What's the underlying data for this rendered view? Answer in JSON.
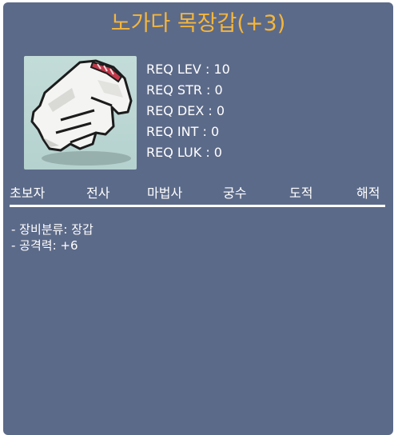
{
  "item": {
    "name": "노가다 목장갑(+3)",
    "icon": "white-work-glove-icon"
  },
  "requirements": [
    {
      "label": "REQ LEV",
      "value": "10"
    },
    {
      "label": "REQ STR",
      "value": "0"
    },
    {
      "label": "REQ DEX",
      "value": "0"
    },
    {
      "label": "REQ INT",
      "value": "0"
    },
    {
      "label": "REQ LUK",
      "value": "0"
    }
  ],
  "jobs": [
    "초보자",
    "전사",
    "마법사",
    "궁수",
    "도적",
    "해적"
  ],
  "stats": [
    "- 장비분류: 장갑",
    "- 공격력: +6"
  ],
  "colors": {
    "panel": "#5c6a89",
    "title": "#f6b63a",
    "text": "#ffffff"
  }
}
